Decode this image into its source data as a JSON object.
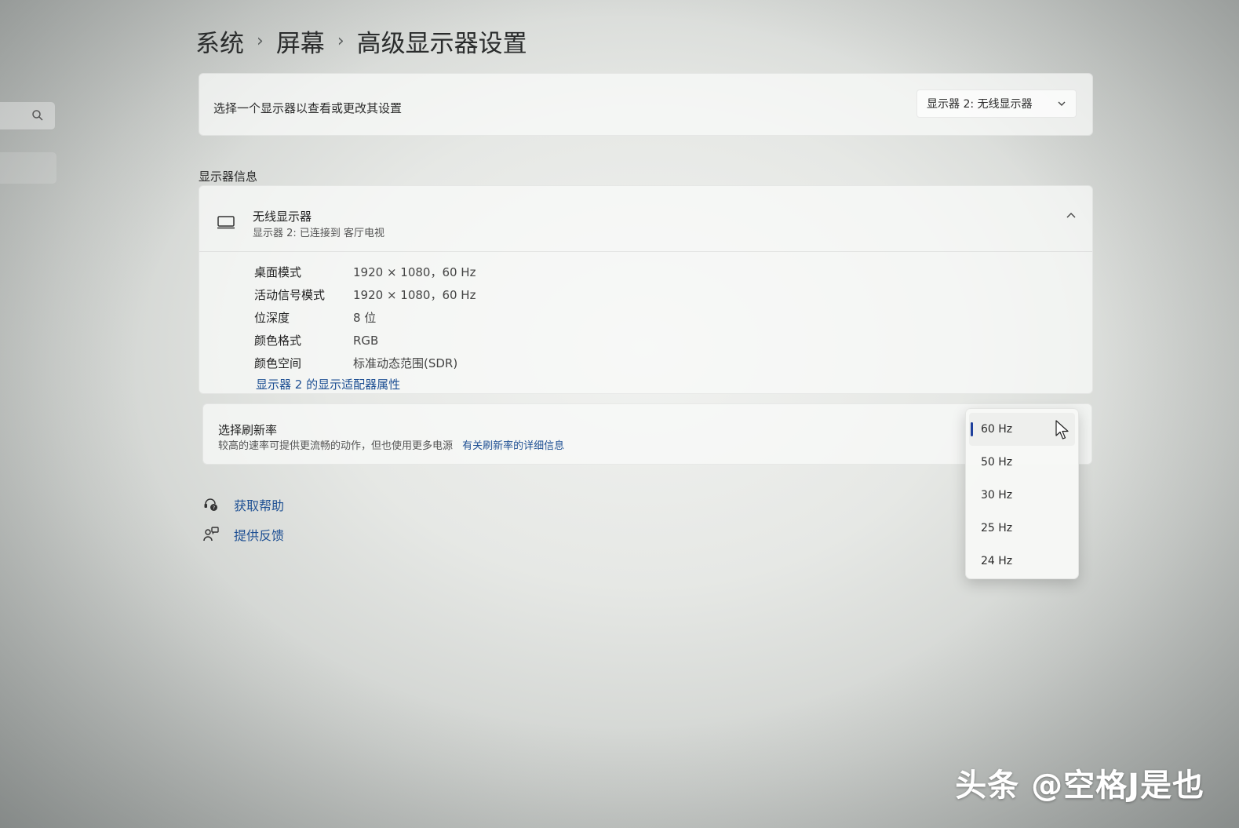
{
  "breadcrumb": {
    "items": [
      "系统",
      "屏幕",
      "高级显示器设置"
    ],
    "separator": "›"
  },
  "display_select": {
    "label": "选择一个显示器以查看或更改其设置",
    "dropdown_value": "显示器 2: 无线显示器"
  },
  "display_info": {
    "section_title": "显示器信息",
    "name": "无线显示器",
    "subtitle": "显示器 2: 已连接到 客厅电视",
    "specs": [
      {
        "key": "桌面模式",
        "value": "1920 × 1080，60 Hz"
      },
      {
        "key": "活动信号模式",
        "value": "1920 × 1080，60 Hz"
      },
      {
        "key": "位深度",
        "value": "8 位"
      },
      {
        "key": "颜色格式",
        "value": "RGB"
      },
      {
        "key": "颜色空间",
        "value": "标准动态范围(SDR)"
      }
    ],
    "adapter_link": "显示器 2 的显示适配器属性"
  },
  "refresh_rate": {
    "title": "选择刷新率",
    "description": "较高的速率可提供更流畅的动作，但也使用更多电源",
    "link": "有关刷新率的详细信息",
    "options": [
      "60 Hz",
      "50 Hz",
      "30 Hz",
      "25 Hz",
      "24 Hz"
    ],
    "selected": "60 Hz"
  },
  "help_links": {
    "get_help": "获取帮助",
    "feedback": "提供反馈"
  },
  "watermark": "头条 @空格J是也",
  "colors": {
    "accent": "#1e3f9c",
    "link": "#1d4f93"
  },
  "icons": [
    "search-icon",
    "chevron-down-icon",
    "monitor-icon",
    "chevron-up-icon",
    "help-icon",
    "feedback-icon",
    "mouse-cursor-icon"
  ]
}
